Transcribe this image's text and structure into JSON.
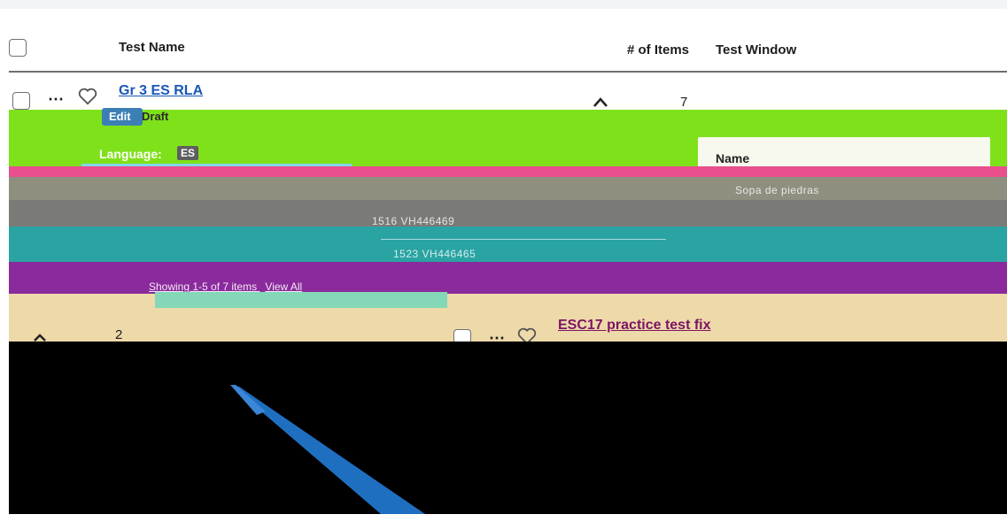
{
  "table": {
    "headers": {
      "test_name": "Test Name",
      "items": "# of Items",
      "window": "Test Window"
    },
    "rows": [
      {
        "name": "Gr 3 ES RLA",
        "items": "7",
        "edit_label": "Edit",
        "status": "Draft",
        "language_label": "Language:",
        "language_code": "ES"
      },
      {
        "name": "ESC17 practice test fix",
        "items": "2"
      }
    ]
  },
  "detail_panel": {
    "name_header": "Name",
    "item_name": "Sopa de piedras",
    "ids": [
      "1516 VH446469",
      "1523 VH446465"
    ],
    "showing_text": "Showing 1-5 of 7 items",
    "view_all": "View All"
  },
  "colors": {
    "link": "#1a57b8",
    "green_band": "#7fe11a",
    "pink_band": "#e84f8c",
    "teal_band": "#2aa3a3",
    "purple_band": "#8b2a9c",
    "tan_band": "#eed9a9",
    "arrow": "#1f6fc0"
  }
}
